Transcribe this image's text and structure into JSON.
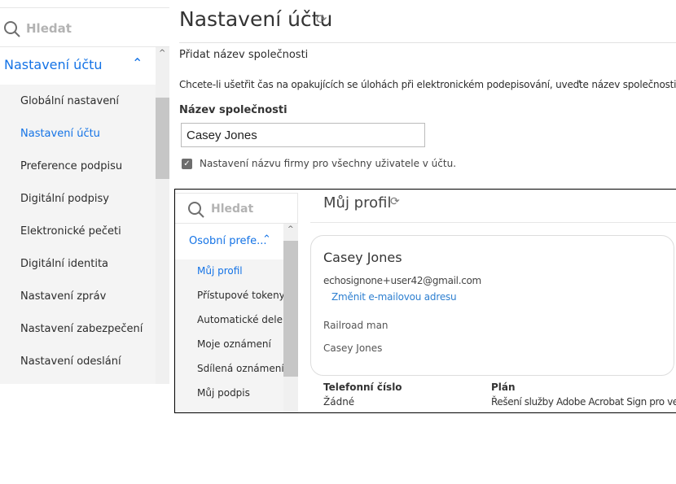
{
  "sidebar": {
    "search_placeholder": "Hledat",
    "section": "Nastavení účtu",
    "items": [
      {
        "label": "Globální nastavení"
      },
      {
        "label": "Nastavení účtu",
        "active": true
      },
      {
        "label": "Preference podpisu"
      },
      {
        "label": "Digitální podpisy"
      },
      {
        "label": "Elektronické pečeti"
      },
      {
        "label": "Digitální identita"
      },
      {
        "label": "Nastavení zpráv"
      },
      {
        "label": "Nastavení zabezpečení"
      },
      {
        "label": "Nastavení odeslání"
      }
    ]
  },
  "main": {
    "title": "Nastavení účtu",
    "subtitle": "Přidat název společnosti",
    "description": "Chcete-li ušetřit čas na opakujících se úlohách při elektronickém podepisování, uveďte název společnosti.",
    "company_label": "Název společnosti",
    "company_value": "Casey Jones",
    "checkbox_label": "Nastavení názvu firmy pro všechny uživatele v účtu.",
    "checkbox_checked": true
  },
  "inset": {
    "sidebar": {
      "search_placeholder": "Hledat",
      "section": "Osobní prefe...",
      "items": [
        {
          "label": "Můj profil",
          "active": true
        },
        {
          "label": "Přístupové tokeny"
        },
        {
          "label": "Automatické dele..."
        },
        {
          "label": "Moje oznámení"
        },
        {
          "label": "Sdílená oznámení"
        },
        {
          "label": "Můj podpis"
        }
      ]
    },
    "title": "Můj profil",
    "card": {
      "name": "Casey Jones",
      "email": "echosignone+user42@gmail.com",
      "change_email": "Změnit e-mailovou adresu",
      "title": "Railroad man",
      "company": "Casey Jones"
    },
    "phone_label": "Telefonní číslo",
    "phone_value": "Žádné",
    "plan_label": "Plán",
    "plan_value": "Řešení služby Adobe Acrobat Sign pro velké"
  },
  "colors": {
    "accent": "#1473e6"
  }
}
